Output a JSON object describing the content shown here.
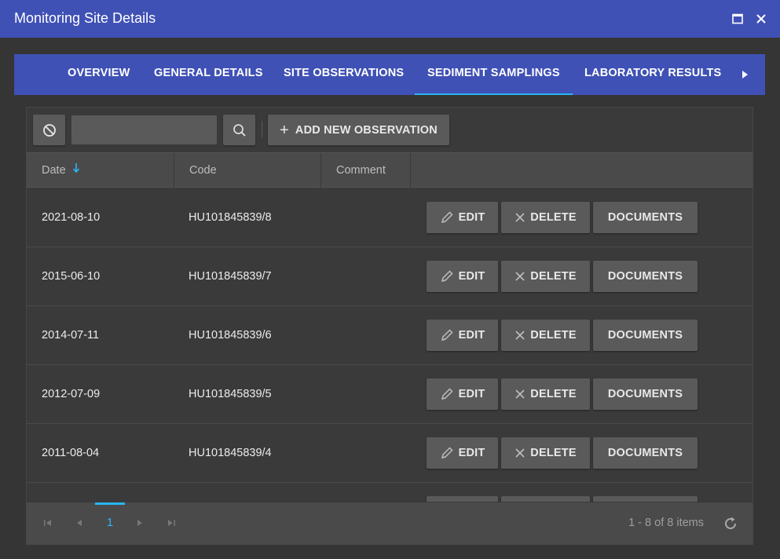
{
  "window": {
    "title": "Monitoring Site Details"
  },
  "tabs": [
    {
      "label": "OVERVIEW"
    },
    {
      "label": "GENERAL DETAILS"
    },
    {
      "label": "SITE OBSERVATIONS"
    },
    {
      "label": "SEDIMENT SAMPLINGS",
      "active": true
    },
    {
      "label": "LABORATORY RESULTS"
    }
  ],
  "toolbar": {
    "search_value": "",
    "add_label": "ADD NEW OBSERVATION"
  },
  "grid": {
    "columns": [
      "Date",
      "Code",
      "Comment"
    ],
    "sort": {
      "column": "Date",
      "direction": "descending"
    },
    "rows": [
      {
        "date": "2021-08-10",
        "code": "HU101845839/8",
        "comment": ""
      },
      {
        "date": "2015-06-10",
        "code": "HU101845839/7",
        "comment": ""
      },
      {
        "date": "2014-07-11",
        "code": "HU101845839/6",
        "comment": ""
      },
      {
        "date": "2012-07-09",
        "code": "HU101845839/5",
        "comment": ""
      },
      {
        "date": "2011-08-04",
        "code": "HU101845839/4",
        "comment": ""
      },
      {
        "date": "",
        "code": "",
        "comment": ""
      }
    ],
    "row_actions": {
      "edit": "EDIT",
      "delete": "DELETE",
      "documents": "DOCUMENTS"
    }
  },
  "pager": {
    "current_page": "1",
    "info": "1 - 8 of 8 items"
  },
  "colors": {
    "accent": "#3f51b5",
    "highlight": "#29b6f6",
    "button": "#5a5a5a",
    "background": "#353535"
  }
}
